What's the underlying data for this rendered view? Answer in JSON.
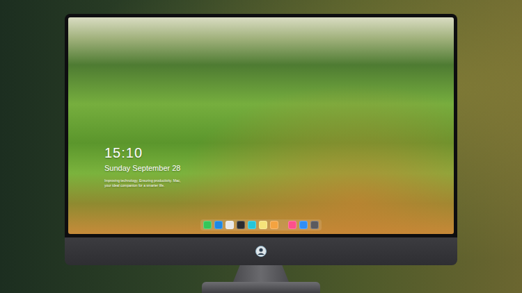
{
  "screen": {
    "clock": "15:10",
    "date": "Sunday September 28",
    "tagline": "Improving technology, Ensuring productivity. Mac, your ideal companion for a smarter life."
  },
  "dock": {
    "groups": [
      {
        "items": [
          {
            "color": "#34c759"
          },
          {
            "color": "#1e88e5"
          },
          {
            "color": "#e8e8e8"
          },
          {
            "color": "#2c2c2e"
          },
          {
            "color": "#26c6da"
          },
          {
            "color": "#f5e27a"
          },
          {
            "color": "#f4a340"
          }
        ]
      },
      {
        "items": [
          {
            "color": "#ff4f8b"
          },
          {
            "color": "#2f8ef5"
          },
          {
            "color": "#5a5a5e"
          }
        ]
      }
    ]
  }
}
